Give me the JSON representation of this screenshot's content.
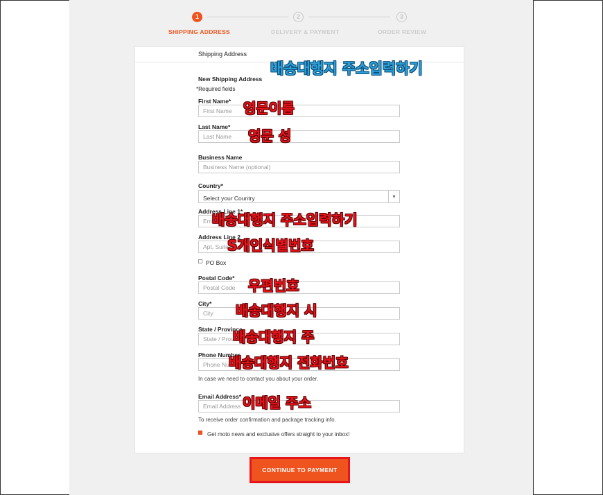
{
  "progress": {
    "steps": [
      {
        "number": "1",
        "label": "SHIPPING ADDRESS"
      },
      {
        "number": "2",
        "label": "DELIVERY & PAYMENT"
      },
      {
        "number": "3",
        "label": "ORDER REVIEW"
      }
    ]
  },
  "form": {
    "card_title": "Shipping Address",
    "section_title": "New Shipping Address",
    "required_note": "*Required fields",
    "first_name": {
      "label": "First Name*",
      "placeholder": "First Name"
    },
    "last_name": {
      "label": "Last Name*",
      "placeholder": "Last Name"
    },
    "business_name": {
      "label": "Business Name",
      "placeholder": "Business Name (optional)"
    },
    "country": {
      "label": "Country*",
      "value": "Select your Country"
    },
    "address1": {
      "label": "Address Line 1*",
      "placeholder": "Ent"
    },
    "address2": {
      "label": "Address Line 2",
      "placeholder": "Apt, Suite"
    },
    "po_box": {
      "label": "PO Box"
    },
    "postal_code": {
      "label": "Postal Code*",
      "placeholder": "Postal Code"
    },
    "city": {
      "label": "City*",
      "placeholder": "City"
    },
    "state": {
      "label": "State / Province",
      "placeholder": "State / Prov"
    },
    "phone": {
      "label": "Phone Number",
      "placeholder": "Phone Nu",
      "help": "In case we need to contact you about your order."
    },
    "email": {
      "label": "Email Address*",
      "placeholder": "Email Address",
      "help": "To receive order confirmation and package tracking info."
    },
    "newsletter": {
      "label": "Get moto news and exclusive offers straight to your inbox!"
    },
    "submit_label": "CONTINUE TO PAYMENT"
  },
  "annotations": {
    "shipping_address": "배송대행지 주소입력하기",
    "first_name": "영문이름",
    "last_name": "영문 성",
    "address1": "배송대행지 주소입력하기",
    "address2": "S개인식별번호",
    "postal": "우편번호",
    "city": "배송대행지 시",
    "state": "배송대행지 주",
    "phone": "배송대행지 전화번호",
    "email": "이메일 주소"
  },
  "colors": {
    "accent": "#f0541e",
    "annotation_red": "#e8141c",
    "annotation_blue": "#2ea0d8"
  }
}
